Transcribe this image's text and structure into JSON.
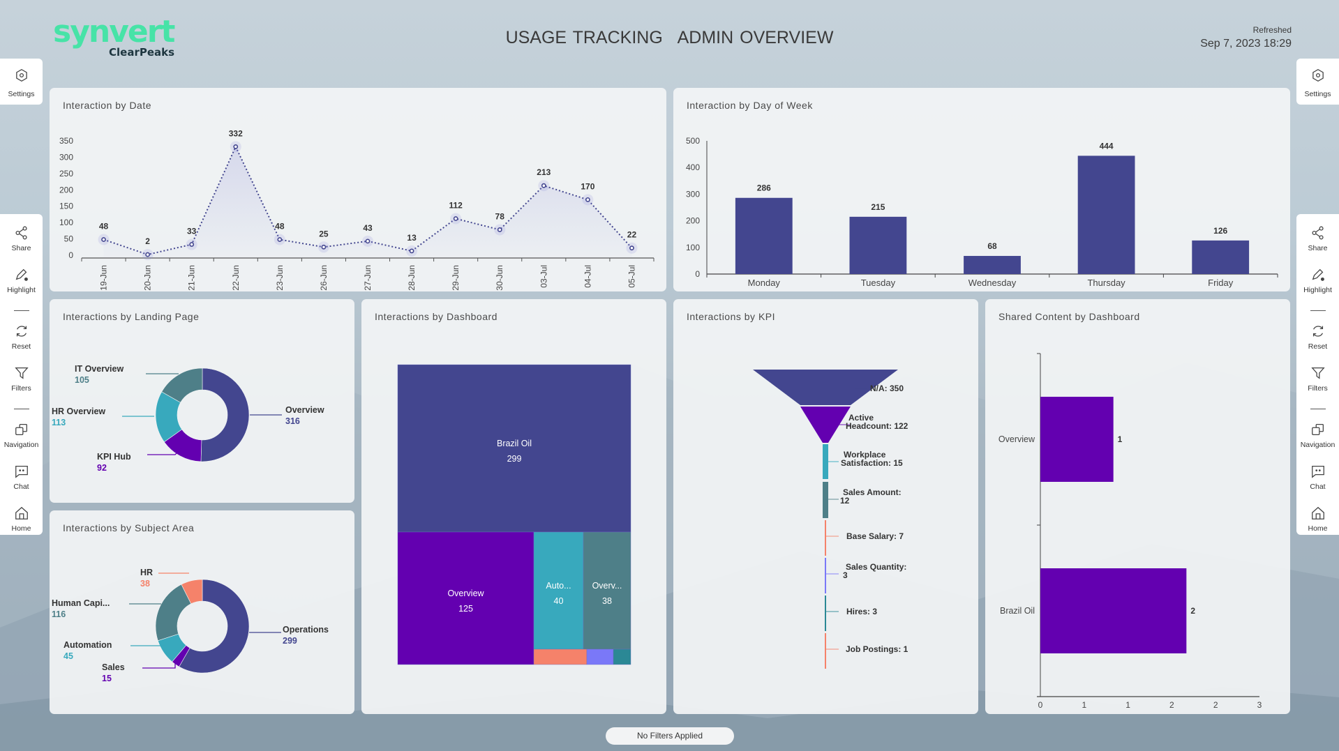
{
  "header": {
    "logo_brand": "synvert",
    "logo_sub": "ClearPeaks",
    "title_left": "USAGE TRACKING",
    "title_right": "ADMIN OVERVIEW",
    "refreshed_label": "Refreshed",
    "refreshed_value": "Sep 7, 2023 18:29"
  },
  "sidebar": {
    "settings": {
      "label": "Settings",
      "icon": "settings-icon"
    },
    "items": [
      {
        "label": "Share",
        "icon": "share-icon"
      },
      {
        "label": "Highlight",
        "icon": "highlight-icon"
      },
      {
        "label": "Reset",
        "icon": "reset-icon"
      },
      {
        "label": "Filters",
        "icon": "filter-icon"
      },
      {
        "label": "Navigation",
        "icon": "navigation-icon"
      },
      {
        "label": "Chat",
        "icon": "chat-icon"
      },
      {
        "label": "Home",
        "icon": "home-icon"
      }
    ]
  },
  "footer": {
    "filter_status": "No Filters Applied"
  },
  "colors": {
    "indigo": "#43468f",
    "purple": "#6300b0",
    "cyan": "#38a9bd",
    "teal": "#4e7f88",
    "salmon": "#f5826a",
    "periwinkle": "#7a78f8",
    "darkteal": "#2b8895"
  },
  "chart_data": [
    {
      "id": "by_date",
      "type": "line",
      "title": "Interaction by Date",
      "categories": [
        "19-Jun",
        "20-Jun",
        "21-Jun",
        "22-Jun",
        "23-Jun",
        "26-Jun",
        "27-Jun",
        "28-Jun",
        "29-Jun",
        "30-Jun",
        "03-Jul",
        "04-Jul",
        "05-Jul"
      ],
      "values": [
        48,
        2,
        33,
        332,
        48,
        25,
        43,
        13,
        112,
        78,
        213,
        170,
        22
      ],
      "yticks": [
        0,
        50,
        100,
        150,
        200,
        250,
        300,
        350
      ],
      "ylim": [
        0,
        350
      ],
      "xlabel": "",
      "ylabel": "",
      "line_style": "dotted",
      "color": "#43468f"
    },
    {
      "id": "by_day",
      "type": "bar",
      "title": "Interaction by Day of Week",
      "categories": [
        "Monday",
        "Tuesday",
        "Wednesday",
        "Thursday",
        "Friday"
      ],
      "values": [
        286,
        215,
        68,
        444,
        126
      ],
      "yticks": [
        0,
        100,
        200,
        300,
        400,
        500
      ],
      "ylim": [
        0,
        500
      ],
      "color": "#43468f"
    },
    {
      "id": "landing_page",
      "type": "pie",
      "donut": true,
      "title": "Interactions by Landing Page",
      "slices": [
        {
          "label": "Overview",
          "value": 316,
          "color": "#43468f"
        },
        {
          "label": "KPI Hub",
          "value": 92,
          "color": "#6300b0"
        },
        {
          "label": "HR Overview",
          "value": 113,
          "color": "#38a9bd"
        },
        {
          "label": "IT Overview",
          "value": 105,
          "color": "#4e7f88"
        }
      ]
    },
    {
      "id": "subject_area",
      "type": "pie",
      "donut": true,
      "title": "Interactions by Subject Area",
      "slices": [
        {
          "label": "Operations",
          "value": 299,
          "color": "#43468f"
        },
        {
          "label": "Sales",
          "value": 15,
          "color": "#6300b0"
        },
        {
          "label": "Automation",
          "value": 45,
          "color": "#38a9bd"
        },
        {
          "label": "Human Capi...",
          "value": 116,
          "color": "#4e7f88"
        },
        {
          "label": "HR",
          "value": 38,
          "color": "#f5826a"
        }
      ]
    },
    {
      "id": "by_dashboard",
      "type": "treemap",
      "title": "Interactions by Dashboard",
      "items": [
        {
          "label": "Brazil Oil",
          "value": 299,
          "color": "#43468f"
        },
        {
          "label": "Overview",
          "value": 125,
          "color": "#6300b0"
        },
        {
          "label": "Auto...",
          "value": 40,
          "color": "#38a9bd"
        },
        {
          "label": "Overv...",
          "value": 38,
          "color": "#4e7f88"
        },
        {
          "label": "",
          "value": null,
          "color": "#f5826a"
        },
        {
          "label": "",
          "value": null,
          "color": "#7a78f8"
        },
        {
          "label": "",
          "value": null,
          "color": "#2b8895"
        }
      ]
    },
    {
      "id": "by_kpi",
      "type": "funnel",
      "title": "Interactions by KPI",
      "stages": [
        {
          "label": "N/A: 350",
          "value": 350,
          "color": "#43468f"
        },
        {
          "label": "Active Headcount: 122",
          "value": 122,
          "color": "#6300b0"
        },
        {
          "label": "Workplace Satisfaction: 15",
          "value": 15,
          "color": "#38a9bd"
        },
        {
          "label": "Sales Amount: 12",
          "value": 12,
          "color": "#4e7f88"
        },
        {
          "label": "Base Salary: 7",
          "value": 7,
          "color": "#f5826a"
        },
        {
          "label": "Sales Quantity: 3",
          "value": 3,
          "color": "#7a78f8"
        },
        {
          "label": "Hires: 3",
          "value": 3,
          "color": "#2b8895"
        },
        {
          "label": "Job Postings: 1",
          "value": 1,
          "color": "#f5826a"
        }
      ]
    },
    {
      "id": "shared_content",
      "type": "bar",
      "orientation": "horizontal",
      "title": "Shared Content by Dashboard",
      "categories": [
        "Overview",
        "Brazil Oil"
      ],
      "values": [
        1,
        2
      ],
      "xticks": [
        "0",
        "1",
        "1",
        "2",
        "2",
        "3"
      ],
      "xlim": [
        0,
        2.5
      ],
      "color": "#6300b0"
    }
  ]
}
